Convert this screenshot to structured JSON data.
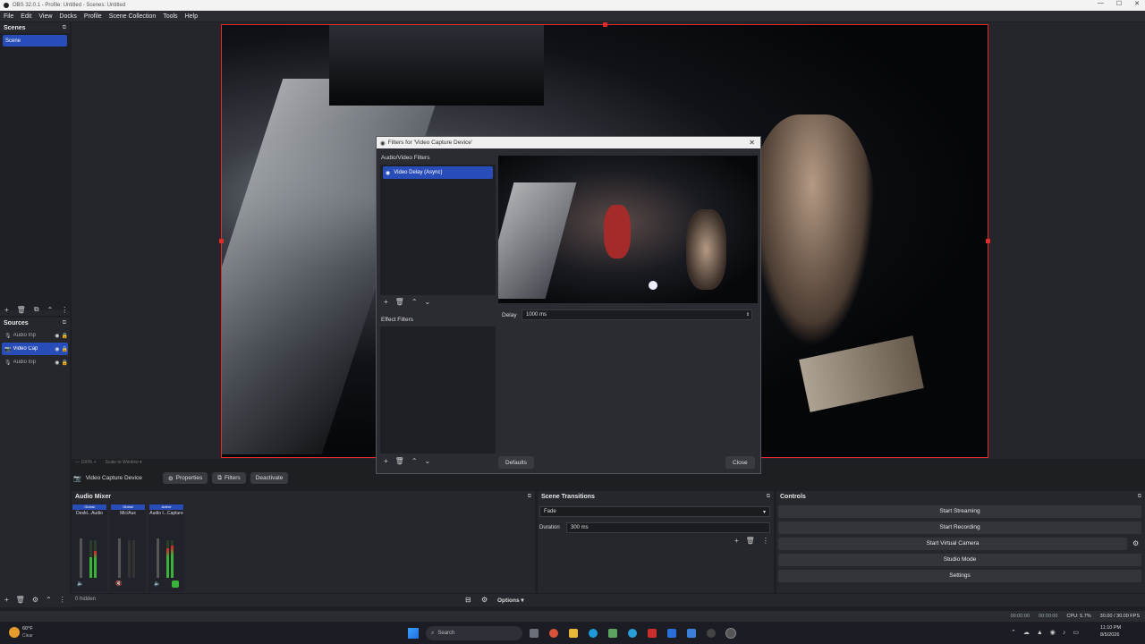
{
  "window": {
    "title": "OBS 32.0.1 - Profile: Untitled - Scenes: Untitled",
    "controls": [
      "—",
      "☐",
      "✕"
    ]
  },
  "menu": [
    "File",
    "Edit",
    "View",
    "Docks",
    "Profile",
    "Scene Collection",
    "Tools",
    "Help"
  ],
  "scenes": {
    "title": "Scenes",
    "items": [
      "Scene"
    ]
  },
  "sources": {
    "title": "Sources",
    "items": [
      {
        "label": "Audio Inp",
        "selected": false
      },
      {
        "label": "Video Cap",
        "selected": true
      },
      {
        "label": "Audio Inp",
        "selected": false
      }
    ]
  },
  "dock_toolbar_glyphs": {
    "add": "+",
    "remove": "🗑",
    "filter": "⧉",
    "up": "⌃",
    "more": "⋮",
    "settings": "⚙"
  },
  "source_toolbar": {
    "source_name": "Video Capture Device",
    "properties": "Properties",
    "filters": "Filters",
    "deactivate": "Deactivate"
  },
  "preview_toolbar": {
    "zoom": "— 100% +",
    "fit": "Scale to Window ▾"
  },
  "dialog": {
    "title": "Filters for 'Video Capture Device'",
    "av_filters_label": "Audio/Video Filters",
    "av_filters": [
      "Video Delay (Async)"
    ],
    "effect_filters_label": "Effect Filters",
    "delay_label": "Delay",
    "delay_value": "1000 ms",
    "defaults": "Defaults",
    "close": "Close"
  },
  "audio_mixer": {
    "title": "Audio Mixer",
    "channels": [
      {
        "tag": "Global",
        "name": "Deskt...Audio",
        "level": 0.55,
        "peak": 0.72
      },
      {
        "tag": "Global",
        "name": "Mic/Aux",
        "level": 0.0,
        "peak": 0.0
      },
      {
        "tag": "Active",
        "name": "Audio I...Capture",
        "level": 0.78,
        "peak": 0.85
      }
    ],
    "hidden": "0 hidden",
    "options": "Options ▾"
  },
  "scene_transitions": {
    "title": "Scene Transitions",
    "transition": "Fade",
    "duration_label": "Duration",
    "duration_value": "300 ms"
  },
  "controls": {
    "title": "Controls",
    "buttons": [
      "Start Streaming",
      "Start Recording",
      "Start Virtual Camera",
      "Studio Mode",
      "Settings"
    ]
  },
  "status": {
    "stream_time": "00:00:00",
    "rec_time": "00:00:00",
    "cpu": "CPU: 5.7%",
    "fps": "30.00 / 30.00 FPS"
  },
  "taskbar": {
    "weather_temp": "60°F",
    "weather_desc": "Clear",
    "search_placeholder": "Search",
    "time": "11:10 PM",
    "date": "8/5/2026"
  },
  "colors": {
    "accent": "#284cb8",
    "preview_border": "#e0292b",
    "meter_green": "#3bb33b",
    "meter_red": "#c9302c"
  }
}
